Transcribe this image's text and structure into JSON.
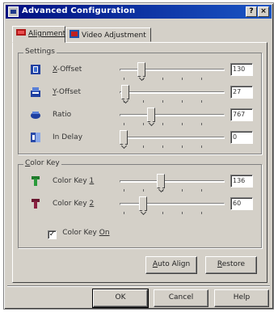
{
  "window": {
    "title": "Advanced Configuration",
    "help_glyph": "?",
    "close_glyph": "×"
  },
  "tabs": [
    {
      "label": "Alignment",
      "active": true,
      "icon": "alignment-icon"
    },
    {
      "label": "Video Adjustment",
      "active": false,
      "icon": "video-adjustment-icon"
    }
  ],
  "settings": {
    "title": "Settings",
    "rows": [
      {
        "label_accel": "X",
        "label_rest": "-Offset",
        "value": "130",
        "position": 0.18,
        "icon": "x-offset-icon"
      },
      {
        "label_accel": "Y",
        "label_rest": "-Offset",
        "value": "27",
        "position": 0.02,
        "icon": "y-offset-icon"
      },
      {
        "label_accel": "",
        "label_rest": "Ratio",
        "value": "767",
        "position": 0.28,
        "icon": "ratio-icon"
      },
      {
        "label_accel": "",
        "label_rest": "In Delay",
        "value": "0",
        "position": 0.0,
        "icon": "in-delay-icon"
      }
    ]
  },
  "color_key": {
    "title_accel": "C",
    "title_rest": "olor Key",
    "rows": [
      {
        "label": "Color Key ",
        "label_accel": "1",
        "value": "136",
        "position": 0.38,
        "icon": "color-key-1-icon"
      },
      {
        "label": "Color Key ",
        "label_accel": "2",
        "value": "60",
        "position": 0.2,
        "icon": "color-key-2-icon"
      }
    ],
    "checkbox": {
      "label": "Color Key ",
      "label_accel": "On",
      "checked": true,
      "check_glyph": "✓"
    }
  },
  "buttons": {
    "auto_align": {
      "accel": "A",
      "rest": "uto Align"
    },
    "restore": {
      "accel": "R",
      "rest": "estore"
    },
    "ok": "OK",
    "cancel": "Cancel",
    "help": "Help"
  },
  "colors": {
    "title_start": "#000f80",
    "title_end": "#1a55c4",
    "face": "#d4d0c8"
  }
}
